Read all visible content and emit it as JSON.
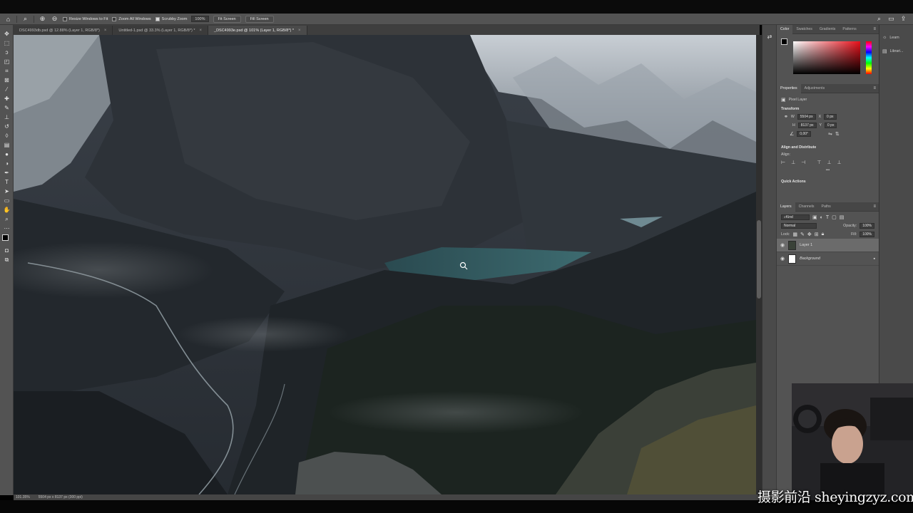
{
  "options_bar": {
    "resize_windows": "Resize Windows to Fit",
    "zoom_all_windows": "Zoom All Windows",
    "scrubby_zoom": "Scrubby Zoom",
    "zoom_value": "100%",
    "fit_screen": "Fit Screen",
    "fill_screen": "Fill Screen"
  },
  "tabs": [
    {
      "label": "DSC4993db.psd @ 12.88% (Layer 1, RGB/8*)",
      "close": "×"
    },
    {
      "label": "Untitled-1.psd @ 33.3% (Layer 1, RGB/8*) *",
      "close": "×"
    },
    {
      "label": "_DSC4993e.psd @ 101% (Layer 1, RGB/8*) *",
      "close": "×"
    }
  ],
  "status_bar": {
    "zoom": "101.35%",
    "doc_info": "5504 px x 8137 px (300 ppi)"
  },
  "color_panel": {
    "tabs": [
      "Color",
      "Swatches",
      "Gradients",
      "Patterns"
    ],
    "hue_color": "#e8101a"
  },
  "properties_panel": {
    "tabs": [
      "Properties",
      "Adjustments"
    ],
    "layer_type": "Pixel Layer",
    "transform_title": "Transform",
    "w_label": "W",
    "w_value": "5504 px",
    "h_label": "H",
    "h_value": "8137 px",
    "x_label": "X",
    "x_value": "0 px",
    "y_label": "Y",
    "y_value": "0 px",
    "angle_value": "0,00°",
    "align_title": "Align and Distribute",
    "align_label": "Align:",
    "more": "•••",
    "quick_actions_title": "Quick Actions"
  },
  "layers_panel": {
    "tabs": [
      "Layers",
      "Channels",
      "Paths"
    ],
    "filter_kind": "Kind",
    "blend_mode": "Normal",
    "opacity_label": "Opacity:",
    "opacity_value": "100%",
    "lock_label": "Lock:",
    "fill_label": "Fill:",
    "fill_value": "100%",
    "layers": [
      {
        "name": "Layer 1",
        "selected": true
      },
      {
        "name": "Background",
        "selected": false,
        "locked": true
      }
    ]
  },
  "learn_panel": {
    "learn": "Learn",
    "libraries": "Librari..."
  },
  "watermark": "摄影前沿 sheyingzyz.com"
}
